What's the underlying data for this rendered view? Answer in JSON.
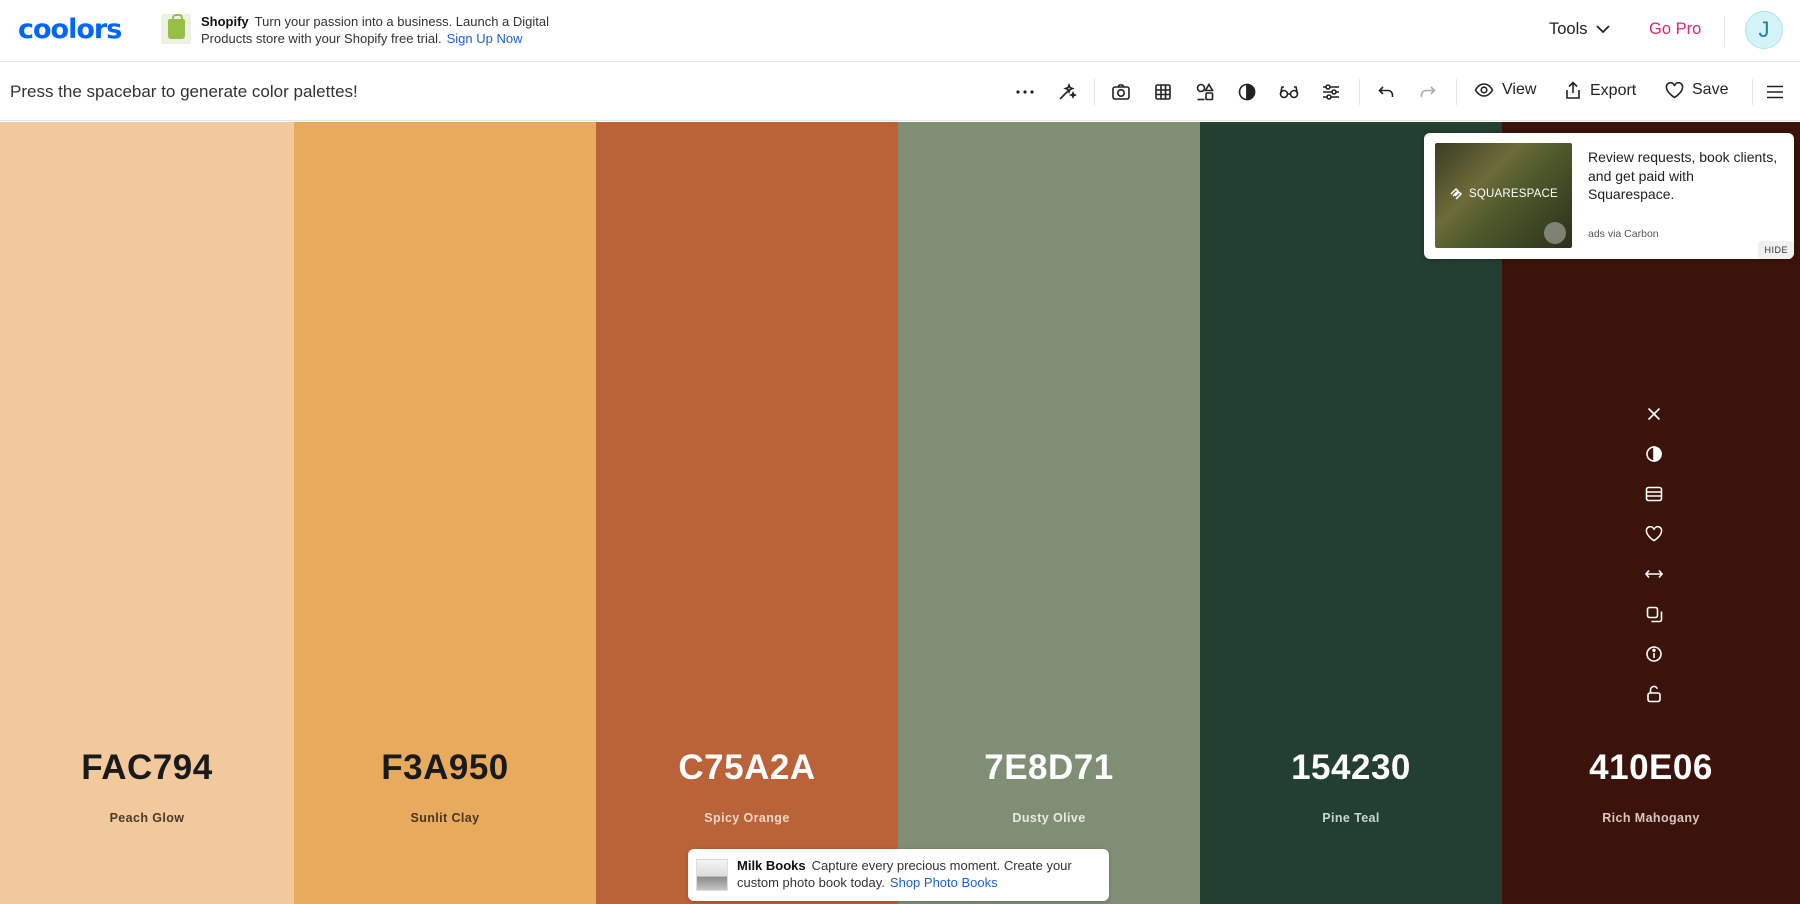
{
  "header": {
    "logo": "coolors",
    "ad": {
      "brand": "Shopify",
      "text": "Turn your passion into a business. Launch a Digital Products store with your Shopify free trial.",
      "cta": "Sign Up Now"
    },
    "tools_label": "Tools",
    "gopro_label": "Go Pro",
    "avatar_initial": "J"
  },
  "toolbar": {
    "hint": "Press the spacebar to generate color palettes!",
    "view_label": "View",
    "export_label": "Export",
    "save_label": "Save"
  },
  "palette": [
    {
      "hex": "FAC794",
      "name": "Peach Glow",
      "color": "#F2C99C",
      "text_color": "#1a1a1a",
      "name_color": "#4a3a2a"
    },
    {
      "hex": "F3A950",
      "name": "Sunlit Clay",
      "color": "#E8AB5E",
      "text_color": "#1a1a1a",
      "name_color": "#4a3520"
    },
    {
      "hex": "C75A2A",
      "name": "Spicy Orange",
      "color": "#BA6238",
      "text_color": "#ffffff",
      "name_color": "#f0d6c8"
    },
    {
      "hex": "7E8D71",
      "name": "Dusty Olive",
      "color": "#818E76",
      "text_color": "#ffffff",
      "name_color": "#e6ebe0"
    },
    {
      "hex": "154230",
      "name": "Pine Teal",
      "color": "#223F31",
      "text_color": "#ffffff",
      "name_color": "#c8d6ce"
    },
    {
      "hex": "410E06",
      "name": "Rich Mahogany",
      "color": "#3B130B",
      "text_color": "#ffffff",
      "name_color": "#dcc6c2"
    }
  ],
  "carbon_ad": {
    "brand": "SQUARESPACE",
    "text": "Review requests, book clients, and get paid with Squarespace.",
    "via": "ads via Carbon",
    "hide": "HIDE"
  },
  "bottom_ad": {
    "brand": "Milk Books",
    "text": "Capture every precious moment. Create your custom photo book today.",
    "cta": "Shop Photo Books"
  },
  "icons": [
    "more-icon",
    "magic-icon",
    "camera-icon",
    "grid-icon",
    "shapes-icon",
    "contrast-icon",
    "glasses-icon",
    "sliders-icon",
    "undo-icon",
    "redo-icon",
    "eye-icon",
    "share-icon",
    "heart-icon",
    "menu-icon",
    "close-icon",
    "shades-icon",
    "palette-icon",
    "drag-icon",
    "copy-icon",
    "info-icon",
    "unlock-icon"
  ]
}
